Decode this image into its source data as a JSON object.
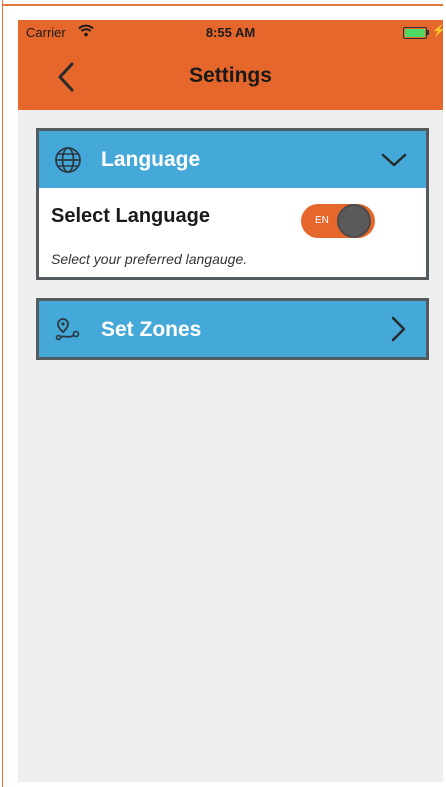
{
  "status_bar": {
    "carrier": "Carrier",
    "time": "8:55 AM"
  },
  "header": {
    "title": "Settings"
  },
  "language_section": {
    "label": "Language",
    "row_title": "Select Language",
    "row_subtitle": "Select your preferred langauge.",
    "toggle_text": "EN"
  },
  "zones_section": {
    "label": "Set Zones"
  },
  "colors": {
    "accent": "#e5672c",
    "section_header": "#44a9d8",
    "background": "#efeff0"
  },
  "icons": [
    "wifi-icon",
    "battery-icon",
    "back-chevron-icon",
    "globe-icon",
    "chevron-down-icon",
    "map-pin-route-icon",
    "chevron-right-icon"
  ]
}
